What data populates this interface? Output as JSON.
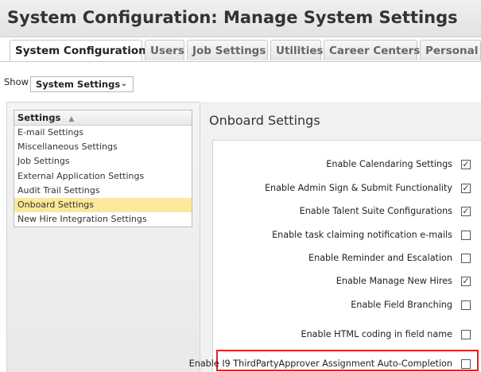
{
  "page": {
    "title": "System Configuration: Manage System Settings"
  },
  "tabs": [
    {
      "label": "System Configuration"
    },
    {
      "label": "Users"
    },
    {
      "label": "Job Settings"
    },
    {
      "label": "Utilities"
    },
    {
      "label": "Career Centers"
    },
    {
      "label": "Personal S"
    }
  ],
  "show": {
    "label": "Show",
    "selected": "System Settings",
    "chevron": "⌄"
  },
  "settings": {
    "header": "Settings",
    "sort_icon": "▲",
    "items": [
      {
        "label": "E-mail Settings"
      },
      {
        "label": "Miscellaneous Settings"
      },
      {
        "label": "Job Settings"
      },
      {
        "label": "External Application Settings"
      },
      {
        "label": "Audit Trail Settings"
      },
      {
        "label": "Onboard Settings"
      },
      {
        "label": "New Hire Integration Settings"
      }
    ],
    "selected_index": 5
  },
  "onboard": {
    "title": "Onboard Settings",
    "options": [
      {
        "label": "Enable Calendaring Settings",
        "checked": true
      },
      {
        "label": "Enable Admin Sign & Submit Functionality",
        "checked": true
      },
      {
        "label": "Enable Talent Suite Configurations",
        "checked": true
      },
      {
        "label": "Enable task claiming notification e-mails",
        "checked": false
      },
      {
        "label": "Enable Reminder and Escalation",
        "checked": false
      },
      {
        "label": "Enable Manage New Hires",
        "checked": true
      },
      {
        "label": "Enable Field Branching",
        "checked": false
      },
      {
        "label": "Enable HTML coding in field name",
        "checked": false
      },
      {
        "label": "Enable I9 ThirdPartyApprover Assignment Auto-Completion",
        "checked": false
      }
    ],
    "checkmark": "✓"
  },
  "colors": {
    "highlight_border": "#d22222",
    "selected_row": "#fbe89a"
  }
}
